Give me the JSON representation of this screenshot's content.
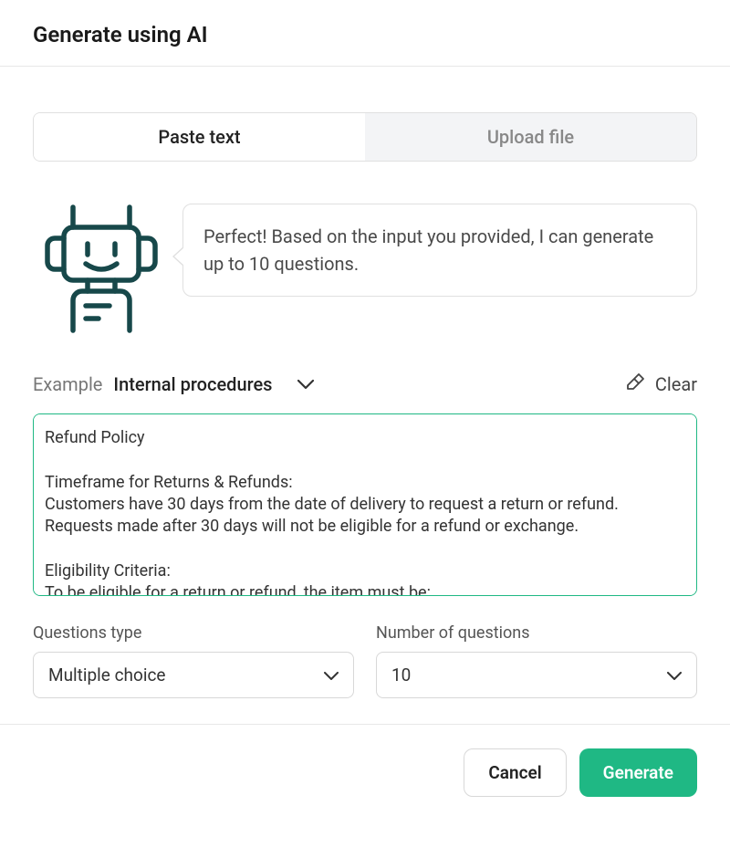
{
  "header": {
    "title": "Generate using AI"
  },
  "tabs": {
    "paste": "Paste text",
    "upload": "Upload file"
  },
  "speech": {
    "message": "Perfect! Based on the input you provided, I can generate up to 10 questions."
  },
  "example": {
    "label": "Example",
    "value": "Internal procedures"
  },
  "clear": {
    "label": "Clear"
  },
  "textarea": {
    "value": "Refund Policy\n\nTimeframe for Returns & Refunds:\nCustomers have 30 days from the date of delivery to request a return or refund. Requests made after 30 days will not be eligible for a refund or exchange.\n\nEligibility Criteria:\nTo be eligible for a return or refund, the item must be:"
  },
  "fields": {
    "questionsType": {
      "label": "Questions type",
      "value": "Multiple choice"
    },
    "numberOfQuestions": {
      "label": "Number of questions",
      "value": "10"
    }
  },
  "footer": {
    "cancel": "Cancel",
    "generate": "Generate"
  }
}
